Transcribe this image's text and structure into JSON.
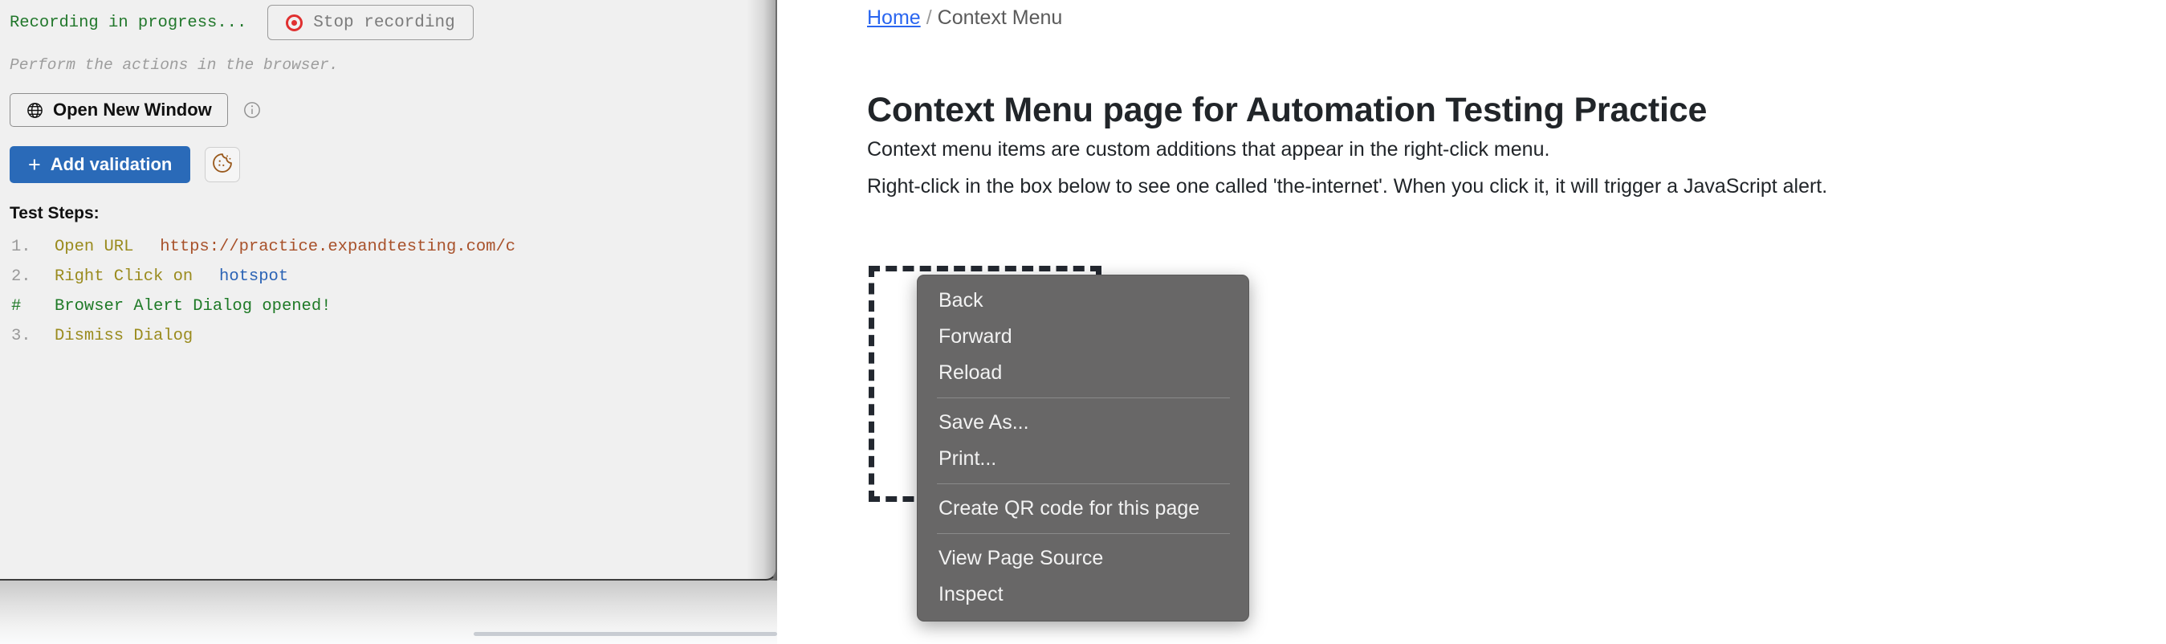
{
  "recorder": {
    "status_text": "Recording in progress...",
    "stop_button_label": "Stop recording",
    "record_icon": "record-dot-icon",
    "hint_text": "Perform the actions in the browser.",
    "open_new_window_label": "Open New Window",
    "globe_icon": "globe-icon",
    "info_icon": "info-icon",
    "add_validation_label": "Add validation",
    "add_validation_plus": "+",
    "cookie_icon": "cookie-icon",
    "accent_blue": "#2a6ab8",
    "record_red": "#e03030",
    "status_green": "#21772b",
    "cookie_brown": "#9a5a1e",
    "test_steps_label": "Test Steps:",
    "steps": [
      {
        "num": "1.",
        "action": "Open URL",
        "url": "https://practice.expandtesting.com/c",
        "target": "",
        "kind": "step"
      },
      {
        "num": "2.",
        "action": "Right Click on",
        "url": "",
        "target": "hotspot",
        "kind": "step"
      },
      {
        "num": "#",
        "action": "Browser Alert Dialog opened!",
        "url": "",
        "target": "",
        "kind": "comment"
      },
      {
        "num": "3.",
        "action": "Dismiss Dialog",
        "url": "",
        "target": "",
        "kind": "step"
      }
    ]
  },
  "page": {
    "breadcrumb": {
      "home": "Home",
      "separator": "/",
      "current": "Context Menu"
    },
    "title": "Context Menu page for Automation Testing Practice",
    "paragraph_1": "Context menu items are custom additions that appear in the right-click menu.",
    "paragraph_2": "Right-click in the box below to see one called 'the-internet'. When you click it, it will trigger a JavaScript alert.",
    "hotspot_label": ""
  },
  "context_menu": {
    "groups": [
      [
        "Back",
        "Forward",
        "Reload"
      ],
      [
        "Save As...",
        "Print..."
      ],
      [
        "Create QR code for this page"
      ],
      [
        "View Page Source",
        "Inspect"
      ]
    ],
    "items": [
      "Back",
      "Forward",
      "Reload",
      "Save As...",
      "Print...",
      "Create QR code for this page",
      "View Page Source",
      "Inspect"
    ],
    "background": "#686767",
    "text_color": "#f2f2f2"
  }
}
